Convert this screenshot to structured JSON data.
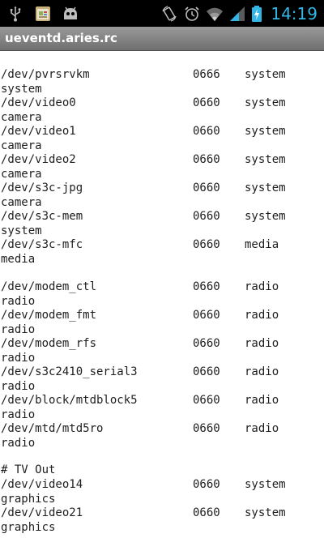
{
  "status_bar": {
    "time": "14:19",
    "left_icons": [
      "usb-icon",
      "notes-app-icon",
      "android-debug-icon"
    ],
    "right_icons": [
      "screen-rotation-icon",
      "alarm-icon",
      "wifi-icon",
      "cell-signal-icon",
      "battery-charging-icon"
    ],
    "time_color": "#33b5e5"
  },
  "title_bar": {
    "title": "ueventd.aries.rc"
  },
  "file": {
    "entries": [
      {
        "path": "/dev/pvrsrvkm",
        "perm": "0666",
        "user": "system",
        "group": "system"
      },
      {
        "path": "/dev/video0",
        "perm": "0660",
        "user": "system",
        "group": "camera"
      },
      {
        "path": "/dev/video1",
        "perm": "0660",
        "user": "system",
        "group": "camera"
      },
      {
        "path": "/dev/video2",
        "perm": "0660",
        "user": "system",
        "group": "camera"
      },
      {
        "path": "/dev/s3c-jpg",
        "perm": "0660",
        "user": "system",
        "group": "camera"
      },
      {
        "path": "/dev/s3c-mem",
        "perm": "0660",
        "user": "system",
        "group": "system"
      },
      {
        "path": "/dev/s3c-mfc",
        "perm": "0660",
        "user": "media",
        "group": "media"
      },
      {
        "path": "/dev/modem_ctl",
        "perm": "0660",
        "user": "radio",
        "group": "radio"
      },
      {
        "path": "/dev/modem_fmt",
        "perm": "0660",
        "user": "radio",
        "group": "radio"
      },
      {
        "path": "/dev/modem_rfs",
        "perm": "0660",
        "user": "radio",
        "group": "radio"
      },
      {
        "path": "/dev/s3c2410_serial3",
        "perm": "0660",
        "user": "radio",
        "group": "radio"
      },
      {
        "path": "/dev/block/mtdblock5",
        "perm": "0660",
        "user": "radio",
        "group": "radio"
      },
      {
        "path": "/dev/mtd/mtd5ro",
        "perm": "0660",
        "user": "radio",
        "group": "radio"
      },
      {
        "path": "/dev/video14",
        "perm": "0660",
        "user": "system",
        "group": "graphics"
      },
      {
        "path": "/dev/video21",
        "perm": "0660",
        "user": "system",
        "group": "graphics"
      }
    ],
    "comment_tv_out": "# TV Out"
  }
}
